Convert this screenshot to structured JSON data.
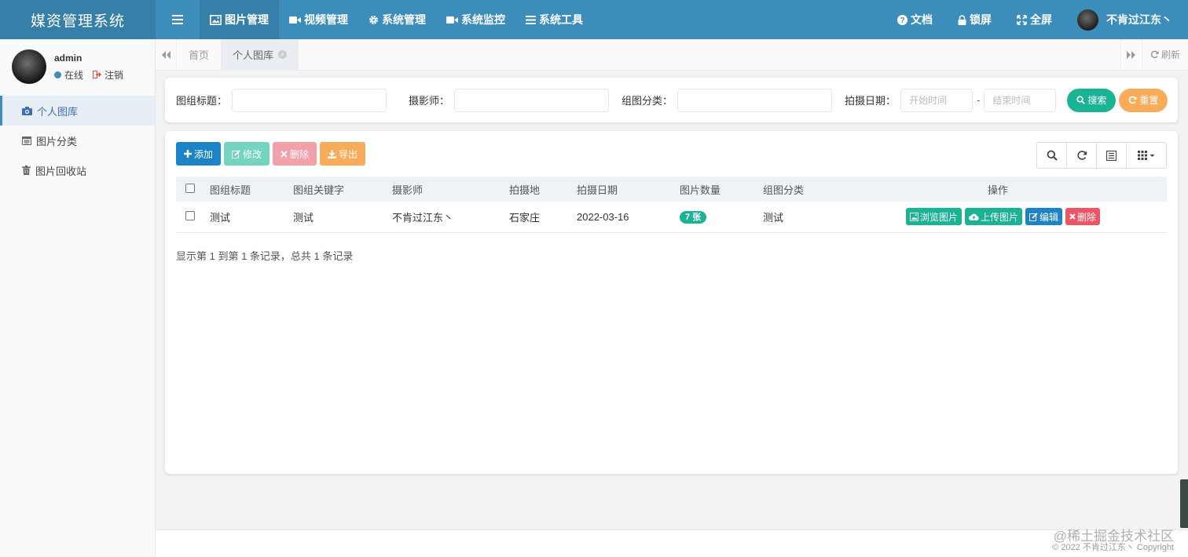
{
  "brand": "媒资管理系统",
  "topnav": [
    {
      "label": "图片管理",
      "icon": "image-icon",
      "active": true
    },
    {
      "label": "视频管理",
      "icon": "video-icon",
      "active": false
    },
    {
      "label": "系统管理",
      "icon": "gear-icon",
      "active": false
    },
    {
      "label": "系统监控",
      "icon": "video-icon",
      "active": false
    },
    {
      "label": "系统工具",
      "icon": "list-icon",
      "active": false
    }
  ],
  "topright": {
    "docs": "文档",
    "lock": "锁屏",
    "fullscreen": "全屏",
    "username": "不肯过江东丶"
  },
  "sidebar": {
    "user": {
      "name": "admin",
      "status": "在线",
      "logout": "注销"
    },
    "items": [
      {
        "label": "个人图库",
        "icon": "camera-icon",
        "active": true
      },
      {
        "label": "图片分类",
        "icon": "calendar-icon",
        "active": false
      },
      {
        "label": "图片回收站",
        "icon": "trash-icon",
        "active": false
      }
    ]
  },
  "tabs": {
    "home": "首页",
    "current": "个人图库",
    "refresh": "刷新"
  },
  "search": {
    "title_label": "图组标题：",
    "photographer_label": "摄影师：",
    "category_label": "组图分类：",
    "date_label": "拍摄日期：",
    "start_placeholder": "开始时间",
    "end_placeholder": "结束时间",
    "search_button": "搜索",
    "reset_button": "重置"
  },
  "toolbar": {
    "add": "添加",
    "edit": "修改",
    "delete": "删除",
    "export": "导出"
  },
  "table": {
    "headers": [
      "图组标题",
      "图组关键字",
      "摄影师",
      "拍摄地",
      "拍摄日期",
      "图片数量",
      "组图分类",
      "操作"
    ],
    "rows": [
      {
        "title": "测试",
        "keywords": "测试",
        "photographer": "不肯过江东丶",
        "location": "石家庄",
        "date": "2022-03-16",
        "count": "7 张",
        "category": "测试"
      }
    ],
    "actions": {
      "browse": "浏览图片",
      "upload": "上传图片",
      "edit": "编辑",
      "delete": "删除"
    }
  },
  "pager_text": "显示第 1 到第 1 条记录，总共 1 条记录",
  "footer": {
    "copyright": "© 2022 不肯过江东丶 Copyright",
    "watermark": "@稀土掘金技术社区"
  }
}
